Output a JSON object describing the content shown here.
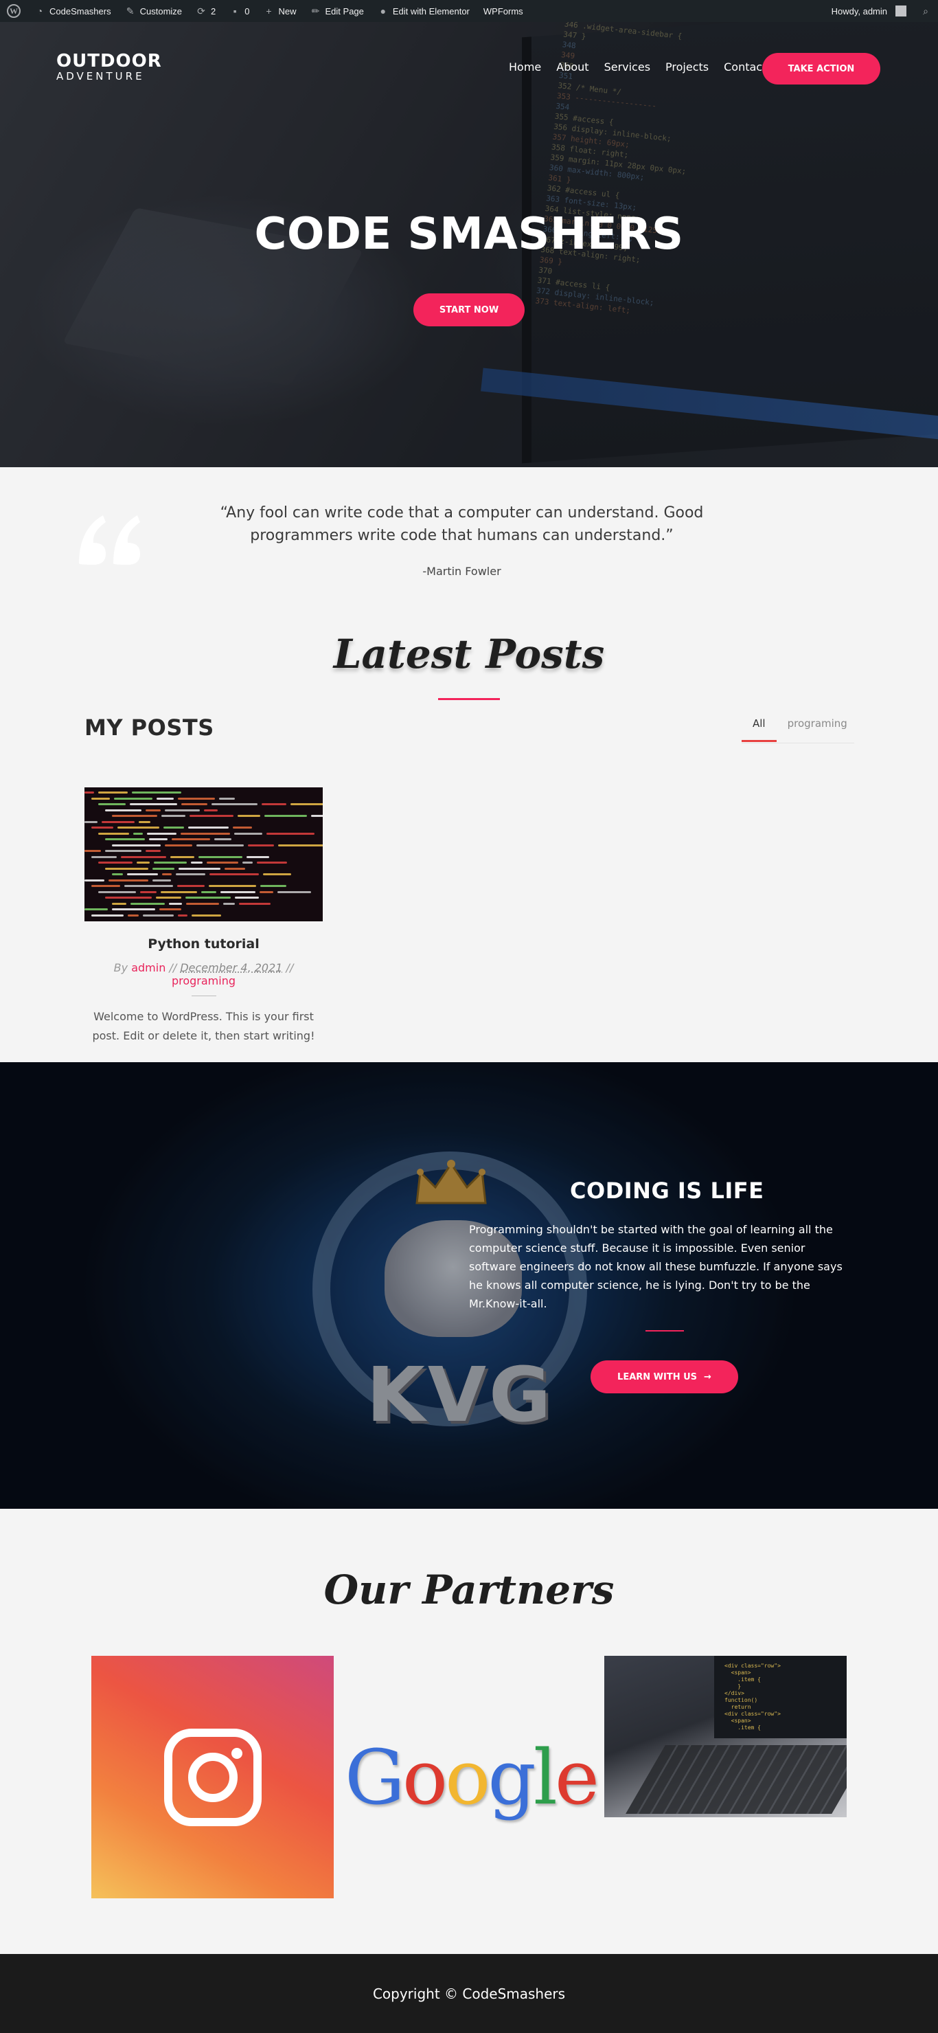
{
  "admin_bar": {
    "site_name": "CodeSmashers",
    "customize": "Customize",
    "updates_count": "2",
    "comments_count": "0",
    "new": "New",
    "edit_page": "Edit Page",
    "edit_elementor": "Edit with Elementor",
    "wpforms": "WPForms",
    "greeting": "Howdy, admin"
  },
  "header": {
    "logo_top": "OUTDOOR",
    "logo_bottom": "ADVENTURE",
    "nav": [
      "Home",
      "About",
      "Services",
      "Projects",
      "Contact"
    ],
    "cta": "TAKE ACTION"
  },
  "hero": {
    "title": "CODE SMASHERS",
    "button": "START NOW"
  },
  "quote": {
    "text": "“Any fool can write code that a computer can understand. Good programmers write code that humans can understand.”",
    "author": "-Martin Fowler"
  },
  "posts_section": {
    "heading": "Latest Posts",
    "subheading": "MY POSTS",
    "filters": [
      "All",
      "programing"
    ],
    "active_filter": "All"
  },
  "post": {
    "title": "Python tutorial",
    "by": "By",
    "author": "admin",
    "sep": "//",
    "date": "December 4, 2021",
    "category": "programing",
    "excerpt": "Welcome to WordPress. This is your first post. Edit or delete it, then start writing!"
  },
  "coding": {
    "title": "CODING IS LIFE",
    "text": "Programming shouldn't be started with the goal of learning all the computer science stuff. Because it is impossible. Even senior software engineers do not know all these bumfuzzle. If anyone says he knows all computer science, he is lying. Don't try to be the Mr.Know-it-all.",
    "button": "LEARN WITH US",
    "button_arrow": "→",
    "badge_text": "KVG"
  },
  "partners": {
    "heading": "Our Partners",
    "google_letters": [
      "G",
      "o",
      "o",
      "g",
      "l",
      "e"
    ],
    "google_colors": [
      "#3b6fd8",
      "#dd3a2f",
      "#f2b630",
      "#3b6fd8",
      "#2e9e4c",
      "#dd3a2f"
    ]
  },
  "footer": {
    "copyright": "Copyright © CodeSmashers"
  },
  "colors": {
    "accent": "#f3245b",
    "admin_bar": "#1d2327",
    "footer": "#1b1b1b"
  }
}
